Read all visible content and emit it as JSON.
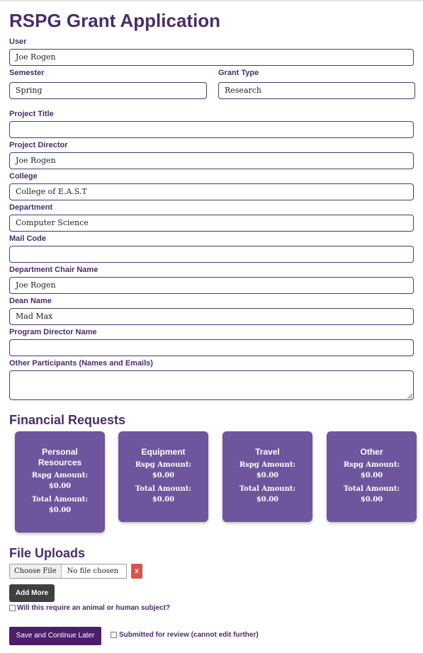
{
  "title": "RSPG Grant Application",
  "fields": {
    "user": {
      "label": "User",
      "value": "Joe Rogen"
    },
    "semester": {
      "label": "Semester",
      "value": "Spring"
    },
    "grant_type": {
      "label": "Grant Type",
      "value": "Research"
    },
    "project_title": {
      "label": "Project Title",
      "value": ""
    },
    "project_director": {
      "label": "Project Director",
      "value": "Joe Rogen"
    },
    "college": {
      "label": "College",
      "value": "College of E.A.S.T"
    },
    "department": {
      "label": "Department",
      "value": "Computer Science"
    },
    "mail_code": {
      "label": "Mail Code",
      "value": ""
    },
    "department_chair_name": {
      "label": "Department Chair Name",
      "value": "Joe Rogen"
    },
    "dean_name": {
      "label": "Dean Name",
      "value": "Mad Max"
    },
    "program_director_name": {
      "label": "Program Director Name",
      "value": ""
    },
    "other_participants": {
      "label": "Other Participants (Names and Emails)",
      "value": ""
    }
  },
  "financial": {
    "heading": "Financial Requests",
    "cards": [
      {
        "title": "Personal Resources",
        "rspg_label": "Rspg Amount:",
        "rspg_value": "$0.00",
        "total_label": "Total Amount:",
        "total_value": "$0.00"
      },
      {
        "title": "Equipment",
        "rspg_label": "Rspg Amount:",
        "rspg_value": "$0.00",
        "total_label": "Total Amount:",
        "total_value": "$0.00"
      },
      {
        "title": "Travel",
        "rspg_label": "Rspg Amount:",
        "rspg_value": "$0.00",
        "total_label": "Total Amount:",
        "total_value": "$0.00"
      },
      {
        "title": "Other",
        "rspg_label": "Rspg Amount:",
        "rspg_value": "$0.00",
        "total_label": "Total Amount:",
        "total_value": "$0.00"
      }
    ]
  },
  "uploads": {
    "heading": "File Uploads",
    "choose_label": "Choose File",
    "no_file_label": "No file chosen",
    "remove_label": "x",
    "add_more_label": "Add More"
  },
  "animal_human_label": "Will this require an animal or human subject?",
  "save_label": "Save and Continue Later",
  "submitted_label": "Submitted for review (cannot edit further)",
  "colors": {
    "accent": "#4b2c6b",
    "card": "#6e559e",
    "danger": "#d9534f",
    "button_dark": "#404040",
    "save": "#4b1f6b"
  }
}
